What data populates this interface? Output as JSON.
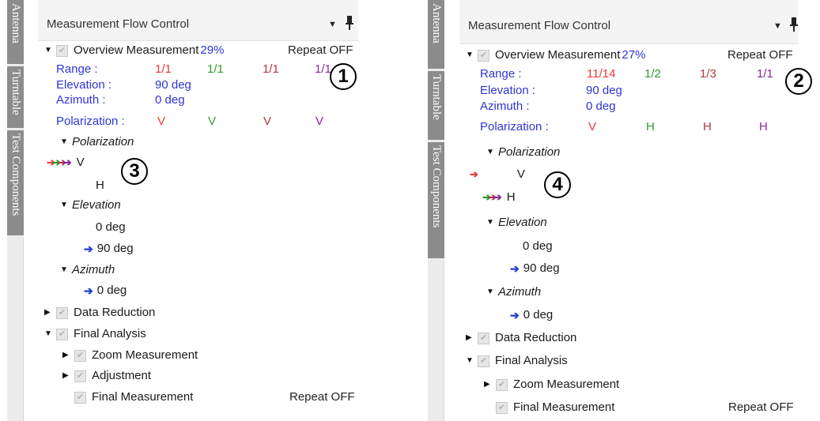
{
  "panels": [
    {
      "side_tabs": [
        "Antenna",
        "Turntable",
        "Test Components"
      ],
      "title": "Measurement Flow Control",
      "overview": {
        "label": "Overview Measurement",
        "progress": "29%",
        "repeat": "Repeat OFF"
      },
      "range": {
        "label": "Range :",
        "values": [
          "1/1",
          "1/1",
          "1/1",
          "1/1"
        ]
      },
      "elevation": {
        "label": "Elevation :",
        "value": "90 deg"
      },
      "azimuth": {
        "label": "Azimuth :",
        "value": "0 deg"
      },
      "polarization": {
        "label": "Polarization :",
        "values": [
          "V",
          "V",
          "V",
          "V"
        ]
      },
      "callout_summary": "1",
      "callout_tree": "3",
      "tree": {
        "polarization_group": "Polarization",
        "pol_v": "V",
        "pol_h": "H",
        "elevation_group": "Elevation",
        "elev_0": "0 deg",
        "elev_90": "90 deg",
        "azimuth_group": "Azimuth",
        "azim_0": "0 deg",
        "data_reduction": "Data Reduction",
        "final_analysis": "Final Analysis",
        "zoom": "Zoom Measurement",
        "adjustment": "Adjustment",
        "final_measurement": "Final Measurement",
        "final_repeat": "Repeat OFF"
      }
    },
    {
      "side_tabs": [
        "Antenna",
        "Turntable",
        "Test Components"
      ],
      "title": "Measurement Flow Control",
      "overview": {
        "label": "Overview Measurement",
        "progress": "27%",
        "repeat": "Repeat OFF"
      },
      "range": {
        "label": "Range :",
        "values": [
          "11/14",
          "1/2",
          "1/3",
          "1/1"
        ]
      },
      "elevation": {
        "label": "Elevation :",
        "value": "90 deg"
      },
      "azimuth": {
        "label": "Azimuth :",
        "value": "0 deg"
      },
      "polarization": {
        "label": "Polarization :",
        "values": [
          "V",
          "H",
          "H",
          "H"
        ]
      },
      "callout_summary": "2",
      "callout_tree": "4",
      "tree": {
        "polarization_group": "Polarization",
        "pol_v": "V",
        "pol_h": "H",
        "elevation_group": "Elevation",
        "elev_0": "0 deg",
        "elev_90": "90 deg",
        "azimuth_group": "Azimuth",
        "azim_0": "0 deg",
        "data_reduction": "Data Reduction",
        "final_analysis": "Final Analysis",
        "zoom": "Zoom Measurement",
        "final_measurement": "Final Measurement",
        "final_repeat": "Repeat OFF"
      }
    }
  ],
  "colors": {
    "label_blue": "#2f35d6",
    "series_red": "#e83a3a",
    "series_green": "#2e9a2e",
    "series_brown": "#b03840",
    "series_purple": "#8a2a9a",
    "side_tab_bg": "#8c8c8c"
  },
  "icons": {
    "expanded": "triangle-down-icon",
    "collapsed": "triangle-right-icon",
    "dropdown": "dropdown-arrow-icon",
    "pin": "pin-icon",
    "checkbox": "checkbox-checked-disabled-icon",
    "arrow": "right-arrow-icon"
  }
}
